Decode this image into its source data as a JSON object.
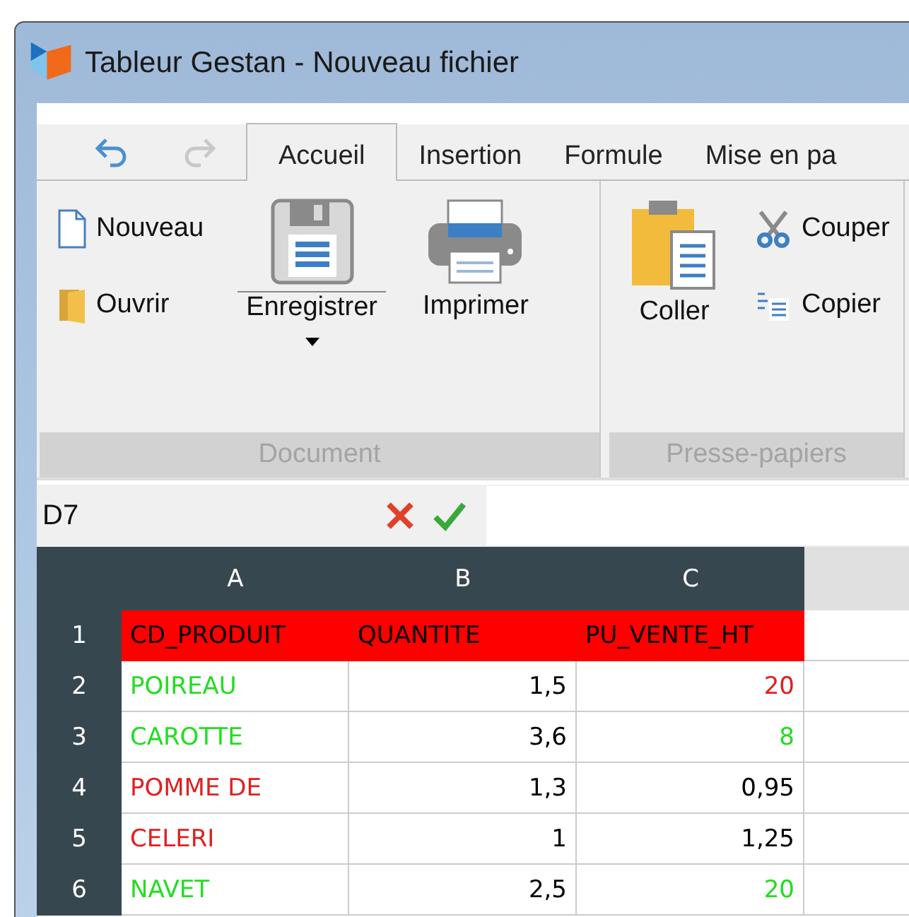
{
  "window": {
    "title": "Tableur Gestan - Nouveau fichier"
  },
  "quick_access": [
    {
      "kind": "undo",
      "disabled": false
    },
    {
      "kind": "redo",
      "disabled": true
    }
  ],
  "tabs": [
    {
      "label": "Accueil",
      "selected": true
    },
    {
      "label": "Insertion",
      "selected": false
    },
    {
      "label": "Formule",
      "selected": false
    },
    {
      "label": "Mise en pa",
      "selected": false
    }
  ],
  "ribbon_groups": [
    {
      "label": "Document",
      "items": [
        {
          "kind": "new",
          "label": "Nouveau"
        },
        {
          "kind": "open",
          "label": "Ouvrir"
        },
        {
          "kind": "save",
          "label": "Enregistrer"
        },
        {
          "kind": "print",
          "label": "Imprimer"
        }
      ]
    },
    {
      "label": "Presse-papiers",
      "items": [
        {
          "kind": "paste",
          "label": "Coller"
        },
        {
          "kind": "cut",
          "label": "Couper"
        },
        {
          "kind": "copy",
          "label": "Copier"
        }
      ]
    }
  ],
  "formula_bar": {
    "cell_ref": "D7"
  },
  "sheet": {
    "columns": [
      "A",
      "B",
      "C"
    ],
    "rows": [
      {
        "number": "1",
        "kind": "header",
        "cells": [
          {
            "text": "CD_PRODUIT",
            "kind": "text"
          },
          {
            "text": "QUANTITE",
            "kind": "text"
          },
          {
            "text": "PU_VENTE_HT",
            "kind": "text"
          }
        ]
      },
      {
        "number": "2",
        "kind": "data",
        "cells": [
          {
            "text": "POIREAU",
            "kind": "text",
            "color": "#22dd22"
          },
          {
            "text": "1,5",
            "kind": "number",
            "color": "#000000"
          },
          {
            "text": "20",
            "kind": "number",
            "color": "#e02020"
          }
        ]
      },
      {
        "number": "3",
        "kind": "data",
        "cells": [
          {
            "text": "CAROTTE",
            "kind": "text",
            "color": "#22dd22"
          },
          {
            "text": "3,6",
            "kind": "number",
            "color": "#000000"
          },
          {
            "text": "8",
            "kind": "number",
            "color": "#22dd22"
          }
        ]
      },
      {
        "number": "4",
        "kind": "data",
        "cells": [
          {
            "text": "POMME DE",
            "kind": "text",
            "color": "#e02020"
          },
          {
            "text": "1,3",
            "kind": "number",
            "color": "#000000"
          },
          {
            "text": "0,95",
            "kind": "number",
            "color": "#000000"
          }
        ]
      },
      {
        "number": "5",
        "kind": "data",
        "cells": [
          {
            "text": "CELERI",
            "kind": "text",
            "color": "#e02020"
          },
          {
            "text": "1",
            "kind": "number",
            "color": "#000000"
          },
          {
            "text": "1,25",
            "kind": "number",
            "color": "#000000"
          }
        ]
      },
      {
        "number": "6",
        "kind": "data",
        "cells": [
          {
            "text": "NAVET",
            "kind": "text",
            "color": "#22dd22"
          },
          {
            "text": "2,5",
            "kind": "number",
            "color": "#000000"
          },
          {
            "text": "20",
            "kind": "number",
            "color": "#22dd22"
          }
        ]
      }
    ]
  }
}
